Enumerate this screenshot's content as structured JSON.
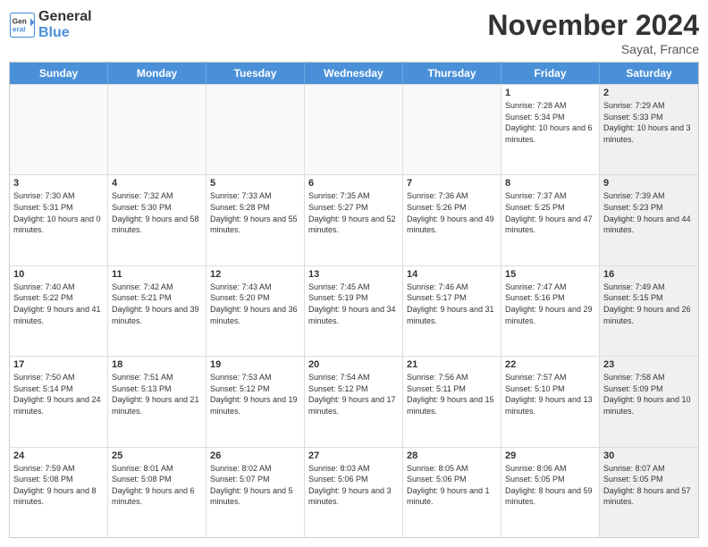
{
  "header": {
    "logo_line1": "General",
    "logo_line2": "Blue",
    "month": "November 2024",
    "location": "Sayat, France"
  },
  "weekdays": [
    "Sunday",
    "Monday",
    "Tuesday",
    "Wednesday",
    "Thursday",
    "Friday",
    "Saturday"
  ],
  "rows": [
    [
      {
        "day": "",
        "info": "",
        "shaded": false,
        "empty": true
      },
      {
        "day": "",
        "info": "",
        "shaded": false,
        "empty": true
      },
      {
        "day": "",
        "info": "",
        "shaded": false,
        "empty": true
      },
      {
        "day": "",
        "info": "",
        "shaded": false,
        "empty": true
      },
      {
        "day": "",
        "info": "",
        "shaded": false,
        "empty": true
      },
      {
        "day": "1",
        "info": "Sunrise: 7:28 AM\nSunset: 5:34 PM\nDaylight: 10 hours and 6 minutes.",
        "shaded": false,
        "empty": false
      },
      {
        "day": "2",
        "info": "Sunrise: 7:29 AM\nSunset: 5:33 PM\nDaylight: 10 hours and 3 minutes.",
        "shaded": true,
        "empty": false
      }
    ],
    [
      {
        "day": "3",
        "info": "Sunrise: 7:30 AM\nSunset: 5:31 PM\nDaylight: 10 hours and 0 minutes.",
        "shaded": false,
        "empty": false
      },
      {
        "day": "4",
        "info": "Sunrise: 7:32 AM\nSunset: 5:30 PM\nDaylight: 9 hours and 58 minutes.",
        "shaded": false,
        "empty": false
      },
      {
        "day": "5",
        "info": "Sunrise: 7:33 AM\nSunset: 5:28 PM\nDaylight: 9 hours and 55 minutes.",
        "shaded": false,
        "empty": false
      },
      {
        "day": "6",
        "info": "Sunrise: 7:35 AM\nSunset: 5:27 PM\nDaylight: 9 hours and 52 minutes.",
        "shaded": false,
        "empty": false
      },
      {
        "day": "7",
        "info": "Sunrise: 7:36 AM\nSunset: 5:26 PM\nDaylight: 9 hours and 49 minutes.",
        "shaded": false,
        "empty": false
      },
      {
        "day": "8",
        "info": "Sunrise: 7:37 AM\nSunset: 5:25 PM\nDaylight: 9 hours and 47 minutes.",
        "shaded": false,
        "empty": false
      },
      {
        "day": "9",
        "info": "Sunrise: 7:39 AM\nSunset: 5:23 PM\nDaylight: 9 hours and 44 minutes.",
        "shaded": true,
        "empty": false
      }
    ],
    [
      {
        "day": "10",
        "info": "Sunrise: 7:40 AM\nSunset: 5:22 PM\nDaylight: 9 hours and 41 minutes.",
        "shaded": false,
        "empty": false
      },
      {
        "day": "11",
        "info": "Sunrise: 7:42 AM\nSunset: 5:21 PM\nDaylight: 9 hours and 39 minutes.",
        "shaded": false,
        "empty": false
      },
      {
        "day": "12",
        "info": "Sunrise: 7:43 AM\nSunset: 5:20 PM\nDaylight: 9 hours and 36 minutes.",
        "shaded": false,
        "empty": false
      },
      {
        "day": "13",
        "info": "Sunrise: 7:45 AM\nSunset: 5:19 PM\nDaylight: 9 hours and 34 minutes.",
        "shaded": false,
        "empty": false
      },
      {
        "day": "14",
        "info": "Sunrise: 7:46 AM\nSunset: 5:17 PM\nDaylight: 9 hours and 31 minutes.",
        "shaded": false,
        "empty": false
      },
      {
        "day": "15",
        "info": "Sunrise: 7:47 AM\nSunset: 5:16 PM\nDaylight: 9 hours and 29 minutes.",
        "shaded": false,
        "empty": false
      },
      {
        "day": "16",
        "info": "Sunrise: 7:49 AM\nSunset: 5:15 PM\nDaylight: 9 hours and 26 minutes.",
        "shaded": true,
        "empty": false
      }
    ],
    [
      {
        "day": "17",
        "info": "Sunrise: 7:50 AM\nSunset: 5:14 PM\nDaylight: 9 hours and 24 minutes.",
        "shaded": false,
        "empty": false
      },
      {
        "day": "18",
        "info": "Sunrise: 7:51 AM\nSunset: 5:13 PM\nDaylight: 9 hours and 21 minutes.",
        "shaded": false,
        "empty": false
      },
      {
        "day": "19",
        "info": "Sunrise: 7:53 AM\nSunset: 5:12 PM\nDaylight: 9 hours and 19 minutes.",
        "shaded": false,
        "empty": false
      },
      {
        "day": "20",
        "info": "Sunrise: 7:54 AM\nSunset: 5:12 PM\nDaylight: 9 hours and 17 minutes.",
        "shaded": false,
        "empty": false
      },
      {
        "day": "21",
        "info": "Sunrise: 7:56 AM\nSunset: 5:11 PM\nDaylight: 9 hours and 15 minutes.",
        "shaded": false,
        "empty": false
      },
      {
        "day": "22",
        "info": "Sunrise: 7:57 AM\nSunset: 5:10 PM\nDaylight: 9 hours and 13 minutes.",
        "shaded": false,
        "empty": false
      },
      {
        "day": "23",
        "info": "Sunrise: 7:58 AM\nSunset: 5:09 PM\nDaylight: 9 hours and 10 minutes.",
        "shaded": true,
        "empty": false
      }
    ],
    [
      {
        "day": "24",
        "info": "Sunrise: 7:59 AM\nSunset: 5:08 PM\nDaylight: 9 hours and 8 minutes.",
        "shaded": false,
        "empty": false
      },
      {
        "day": "25",
        "info": "Sunrise: 8:01 AM\nSunset: 5:08 PM\nDaylight: 9 hours and 6 minutes.",
        "shaded": false,
        "empty": false
      },
      {
        "day": "26",
        "info": "Sunrise: 8:02 AM\nSunset: 5:07 PM\nDaylight: 9 hours and 5 minutes.",
        "shaded": false,
        "empty": false
      },
      {
        "day": "27",
        "info": "Sunrise: 8:03 AM\nSunset: 5:06 PM\nDaylight: 9 hours and 3 minutes.",
        "shaded": false,
        "empty": false
      },
      {
        "day": "28",
        "info": "Sunrise: 8:05 AM\nSunset: 5:06 PM\nDaylight: 9 hours and 1 minute.",
        "shaded": false,
        "empty": false
      },
      {
        "day": "29",
        "info": "Sunrise: 8:06 AM\nSunset: 5:05 PM\nDaylight: 8 hours and 59 minutes.",
        "shaded": false,
        "empty": false
      },
      {
        "day": "30",
        "info": "Sunrise: 8:07 AM\nSunset: 5:05 PM\nDaylight: 8 hours and 57 minutes.",
        "shaded": true,
        "empty": false
      }
    ]
  ]
}
